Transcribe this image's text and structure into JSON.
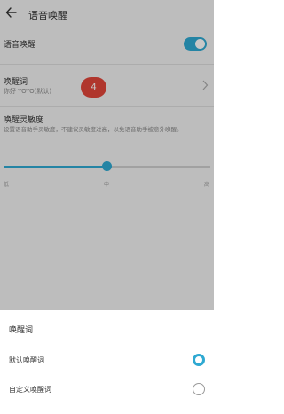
{
  "header": {
    "title": "语音唤醒"
  },
  "toggle_row": {
    "label": "语音唤醒",
    "enabled": true
  },
  "wake_word": {
    "label": "唤醒词",
    "current": "你好 YOYO(默认)"
  },
  "badge": {
    "value": "4"
  },
  "sensitivity": {
    "label": "唤醒灵敏度",
    "description": "设置语音助手灵敏度，不建议灵敏度过高，以免语音助手被意外唤醒。",
    "level": 0.5,
    "ticks": [
      "低",
      "中",
      "高"
    ]
  },
  "sheet": {
    "title": "唤醒词",
    "options": [
      {
        "label": "默认唤醒词",
        "selected": true
      },
      {
        "label": "自定义唤醒词",
        "selected": false
      }
    ]
  },
  "colors": {
    "accent": "#2fa9d2",
    "badge": "#e2463a"
  }
}
